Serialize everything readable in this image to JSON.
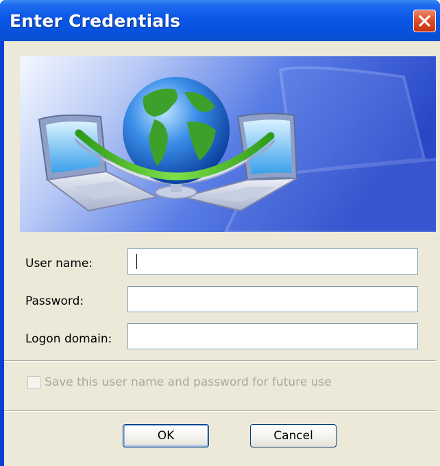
{
  "window": {
    "title": "Enter Credentials",
    "close_icon": "close-x-icon"
  },
  "banner": {
    "description_icons": [
      "globe-icon",
      "laptop-icon",
      "laptop-icon"
    ]
  },
  "form": {
    "username_label": "User name:",
    "username_value": "",
    "password_label": "Password:",
    "password_value": "",
    "domain_label": "Logon domain:",
    "domain_value": ""
  },
  "save_checkbox": {
    "label": "Save this user name and password for future use",
    "checked": false,
    "enabled": false
  },
  "buttons": {
    "ok_label": "OK",
    "cancel_label": "Cancel"
  },
  "colors": {
    "titlebar": "#0a57e6",
    "client": "#ece9d8",
    "close": "#e0502a",
    "banner": "#4a6ee0"
  }
}
